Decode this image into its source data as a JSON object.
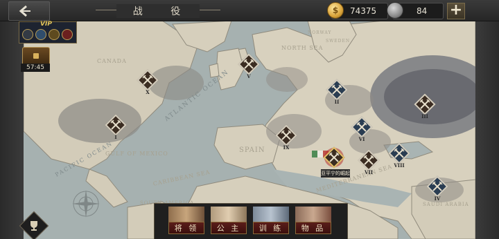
{
  "header": {
    "title": "战 役",
    "gold": "74375",
    "medals": "84",
    "add_label": "+"
  },
  "vip": {
    "label": "VIP",
    "chest_timer": "57:45"
  },
  "map": {
    "place_labels": {
      "canada": "CANADA",
      "north_sea": "NORTH SEA",
      "atlantic": "ATLANTIC OCEAN",
      "spain": "SPAIN",
      "gulf_mexico": "GULF OF MEXICO",
      "pacific": "PACIFIC OCEAN",
      "caribbean": "CARIBBEAN SEA",
      "mediterranean": "MEDITERRANEAN SEA",
      "saudi": "SAUDI ARABIA",
      "norway": "NORWAY",
      "sweden": "SWEDEN",
      "south_america": "SOUTH AMERICA"
    },
    "battles": [
      {
        "id": "I",
        "type": "dark"
      },
      {
        "id": "II",
        "type": "blue"
      },
      {
        "id": "III",
        "type": "dark"
      },
      {
        "id": "IV",
        "type": "blue"
      },
      {
        "id": "V",
        "type": "dark"
      },
      {
        "id": "VI",
        "type": "blue"
      },
      {
        "id": "VII",
        "type": "dark"
      },
      {
        "id": "VIII",
        "type": "blue"
      },
      {
        "id": "IX",
        "type": "dark"
      },
      {
        "id": "X",
        "type": "dark"
      }
    ],
    "hint": "亚平宁的崛起"
  },
  "bottom_tabs": [
    {
      "label": "将 领"
    },
    {
      "label": "公 主"
    },
    {
      "label": "训 练"
    },
    {
      "label": "物 品"
    }
  ],
  "colors": {
    "land": "#d6cfbd",
    "sea": "#a9b4b3",
    "accent": "#5a1d1a",
    "gold": "#d9a33a"
  }
}
